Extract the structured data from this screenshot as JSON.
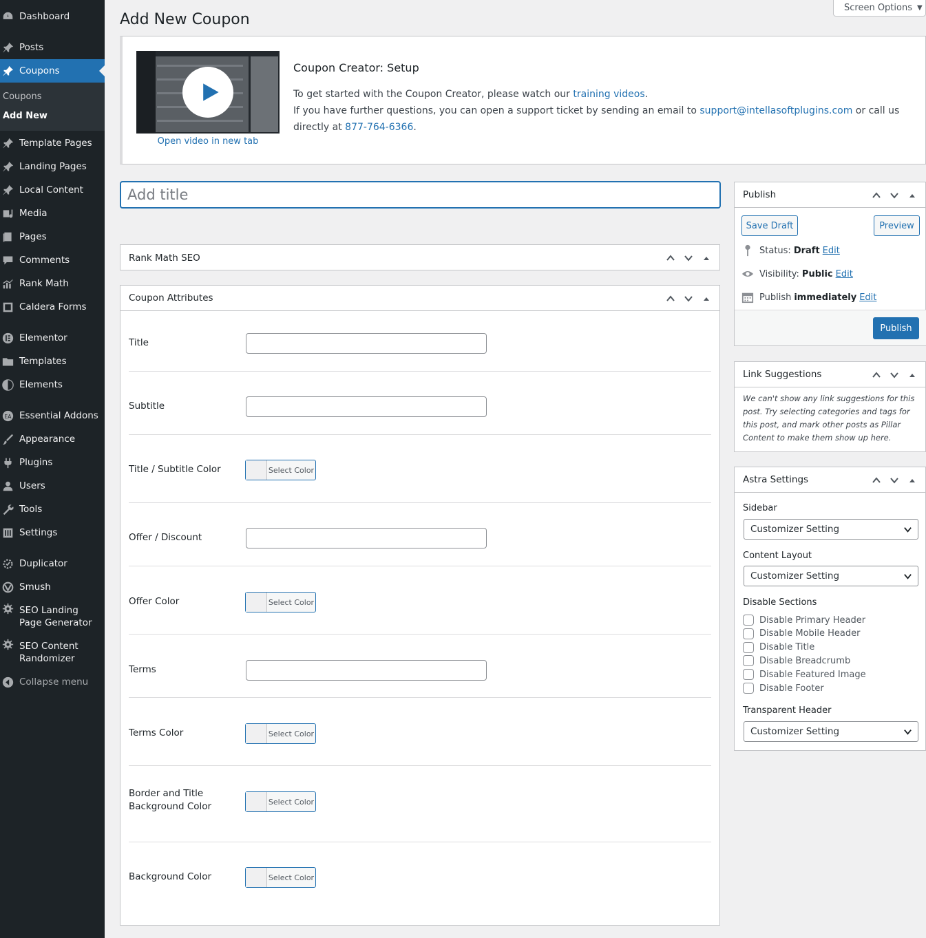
{
  "sidebar": {
    "items": [
      {
        "label": "Dashboard",
        "icon": "dashboard-icon"
      },
      {
        "label": "Posts",
        "icon": "pin-icon"
      },
      {
        "label": "Coupons",
        "icon": "pin-icon"
      },
      {
        "label": "Template Pages",
        "icon": "pin-icon"
      },
      {
        "label": "Landing Pages",
        "icon": "pin-icon"
      },
      {
        "label": "Local Content",
        "icon": "pin-icon"
      },
      {
        "label": "Media",
        "icon": "media-icon"
      },
      {
        "label": "Pages",
        "icon": "pages-icon"
      },
      {
        "label": "Comments",
        "icon": "comments-icon"
      },
      {
        "label": "Rank Math",
        "icon": "chart-icon"
      },
      {
        "label": "Caldera Forms",
        "icon": "form-icon"
      },
      {
        "label": "Elementor",
        "icon": "elementor-icon"
      },
      {
        "label": "Templates",
        "icon": "folder-icon"
      },
      {
        "label": "Elements",
        "icon": "elements-icon"
      },
      {
        "label": "Essential Addons",
        "icon": "ea-icon"
      },
      {
        "label": "Appearance",
        "icon": "brush-icon"
      },
      {
        "label": "Plugins",
        "icon": "plug-icon"
      },
      {
        "label": "Users",
        "icon": "user-icon"
      },
      {
        "label": "Tools",
        "icon": "wrench-icon"
      },
      {
        "label": "Settings",
        "icon": "settings-icon"
      },
      {
        "label": "Duplicator",
        "icon": "duplicator-icon"
      },
      {
        "label": "Smush",
        "icon": "smush-icon"
      },
      {
        "label": "SEO Landing Page Generator",
        "icon": "gear-icon"
      },
      {
        "label": "SEO Content Randomizer",
        "icon": "gear-icon"
      }
    ],
    "submenu": {
      "parent": "Coupons",
      "active": "Add New"
    },
    "collapse": "Collapse menu"
  },
  "screen_options": "Screen Options",
  "page_title": "Add New Coupon",
  "notice": {
    "title": "Coupon Creator: Setup",
    "line1_pre": "To get started with the Coupon Creator, please watch our ",
    "line1_link": "training videos",
    "line1_post": ".",
    "line2_pre": "If you have further questions, you can open a support ticket by sending an email to ",
    "line2_email": "support@intellasoftplugins.com",
    "line2_mid": " or call us",
    "line3_pre": "directly at ",
    "line3_phone": "877-764-6366",
    "line3_post": ".",
    "video_link": "Open video in new tab"
  },
  "title_placeholder": "Add title",
  "rank_math_box": {
    "title": "Rank Math SEO"
  },
  "coupon_attributes": {
    "title": "Coupon Attributes",
    "select_color_label": "Select Color",
    "fields": [
      {
        "label": "Title",
        "type": "text",
        "value": ""
      },
      {
        "label": "Subtitle",
        "type": "text",
        "value": ""
      },
      {
        "label": "Title / Subtitle Color",
        "type": "color"
      },
      {
        "label": "Offer / Discount",
        "type": "text",
        "value": ""
      },
      {
        "label": "Offer Color",
        "type": "color"
      },
      {
        "label": "Terms",
        "type": "text",
        "value": ""
      },
      {
        "label": "Terms Color",
        "type": "color"
      },
      {
        "label": "Border and Title\nBackground Color",
        "type": "color"
      },
      {
        "label": "Background Color",
        "type": "color"
      }
    ]
  },
  "publish": {
    "title": "Publish",
    "save_draft": "Save Draft",
    "preview": "Preview",
    "status_label": "Status:",
    "status_value": "Draft",
    "visibility_label": "Visibility:",
    "visibility_value": "Public",
    "publish_label": "Publish",
    "publish_value": "immediately",
    "edit": "Edit",
    "publish_button": "Publish"
  },
  "link_suggestions": {
    "title": "Link Suggestions",
    "text": "We can't show any link suggestions for this post. Try selecting categories and tags for this post, and mark other posts as Pillar Content to make them show up here."
  },
  "astra": {
    "title": "Astra Settings",
    "sidebar_label": "Sidebar",
    "sidebar_value": "Customizer Setting",
    "content_layout_label": "Content Layout",
    "content_layout_value": "Customizer Setting",
    "disable_sections_label": "Disable Sections",
    "checkboxes": [
      "Disable Primary Header",
      "Disable Mobile Header",
      "Disable Title",
      "Disable Breadcrumb",
      "Disable Featured Image",
      "Disable Footer"
    ],
    "transparent_header_label": "Transparent Header",
    "transparent_header_value": "Customizer Setting"
  }
}
